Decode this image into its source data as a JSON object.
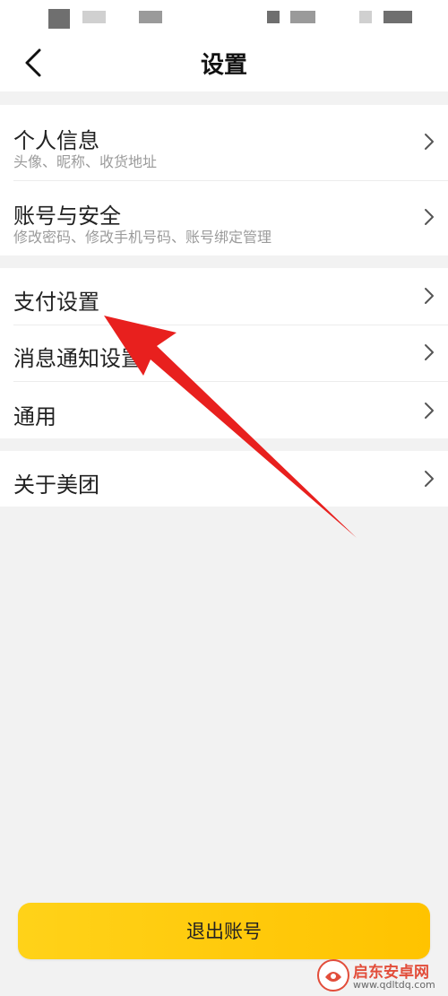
{
  "header": {
    "title": "设置"
  },
  "settings": {
    "group1": [
      {
        "title": "个人信息",
        "subtitle": "头像、昵称、收货地址"
      },
      {
        "title": "账号与安全",
        "subtitle": "修改密码、修改手机号码、账号绑定管理"
      }
    ],
    "group2": [
      {
        "title": "支付设置"
      },
      {
        "title": "消息通知设置"
      },
      {
        "title": "通用"
      }
    ],
    "group3": [
      {
        "title": "关于美团"
      }
    ]
  },
  "logout_label": "退出账号",
  "watermark": {
    "name": "启东安卓网",
    "url": "www.qdltdq.com"
  },
  "colors": {
    "accent": "#ffc300",
    "annotation_arrow": "#e8201e",
    "background": "#f2f2f2"
  }
}
